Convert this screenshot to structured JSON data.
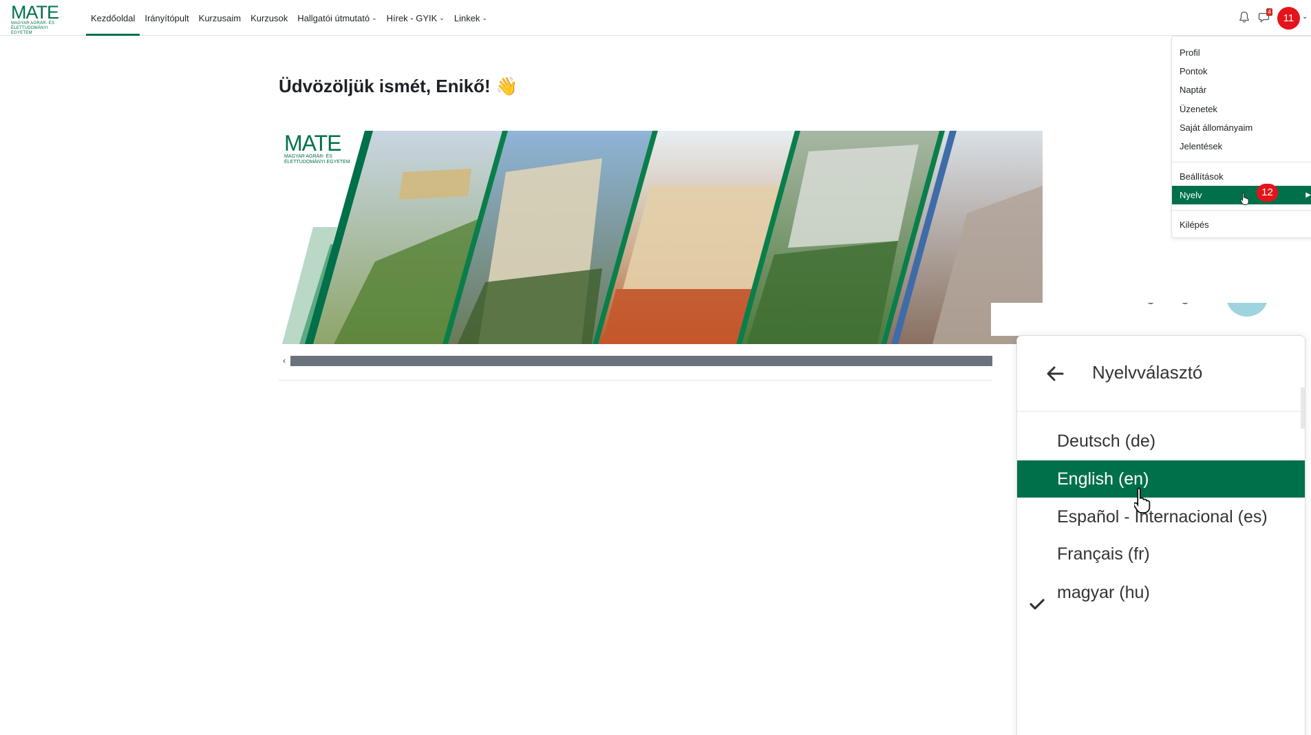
{
  "navbar": {
    "logo": {
      "word": "MATE",
      "subtitle_line1": "MAGYAR AGRÁR- ÉS",
      "subtitle_line2": "ÉLETTUDOMÁNYI EGYETEM"
    },
    "items": [
      {
        "label": "Kezdőoldal",
        "active": true,
        "has_dropdown": false
      },
      {
        "label": "Irányítópult",
        "active": false,
        "has_dropdown": false
      },
      {
        "label": "Kurzusaim",
        "active": false,
        "has_dropdown": false
      },
      {
        "label": "Kurzusok",
        "active": false,
        "has_dropdown": false
      },
      {
        "label": "Hallgatói útmutató",
        "active": false,
        "has_dropdown": true
      },
      {
        "label": "Hírek - GYIK",
        "active": false,
        "has_dropdown": true
      },
      {
        "label": "Linkek",
        "active": false,
        "has_dropdown": true
      }
    ],
    "chat_badge": "4",
    "avatar_label": "11"
  },
  "main": {
    "welcome": "Üdvözöljük ismét, Enikő!",
    "wave_emoji": "👋",
    "banner_logo": {
      "word": "MATE",
      "subtitle_line1": "MAGYAR AGRÁR- ÉS",
      "subtitle_line2": "ÉLETTUDOMÁNYI EGYETEM"
    }
  },
  "user_menu": {
    "items": [
      {
        "label": "Profil"
      },
      {
        "label": "Pontok"
      },
      {
        "label": "Naptár"
      },
      {
        "label": "Üzenetek"
      },
      {
        "label": "Saját állományaim"
      },
      {
        "label": "Jelentések"
      },
      {
        "label": "Beállítások"
      },
      {
        "label": "Nyelv",
        "active": true
      },
      {
        "label": "Kilépés"
      }
    ],
    "step_badge": "12"
  },
  "language_panel": {
    "title": "Nyelvválasztó",
    "languages": [
      {
        "label": "Deutsch (de)",
        "active": false,
        "selected": false
      },
      {
        "label": "English (en)",
        "active": true,
        "selected": false
      },
      {
        "label": "Español - Internacional (es)",
        "active": false,
        "selected": false
      },
      {
        "label": "Français (fr)",
        "active": false,
        "selected": false
      },
      {
        "label": "magyar (hu)",
        "active": false,
        "selected": true
      }
    ]
  },
  "colors": {
    "brand_green": "#00704a",
    "badge_red": "#e5141b",
    "scroll_thumb": "#6a737b"
  }
}
